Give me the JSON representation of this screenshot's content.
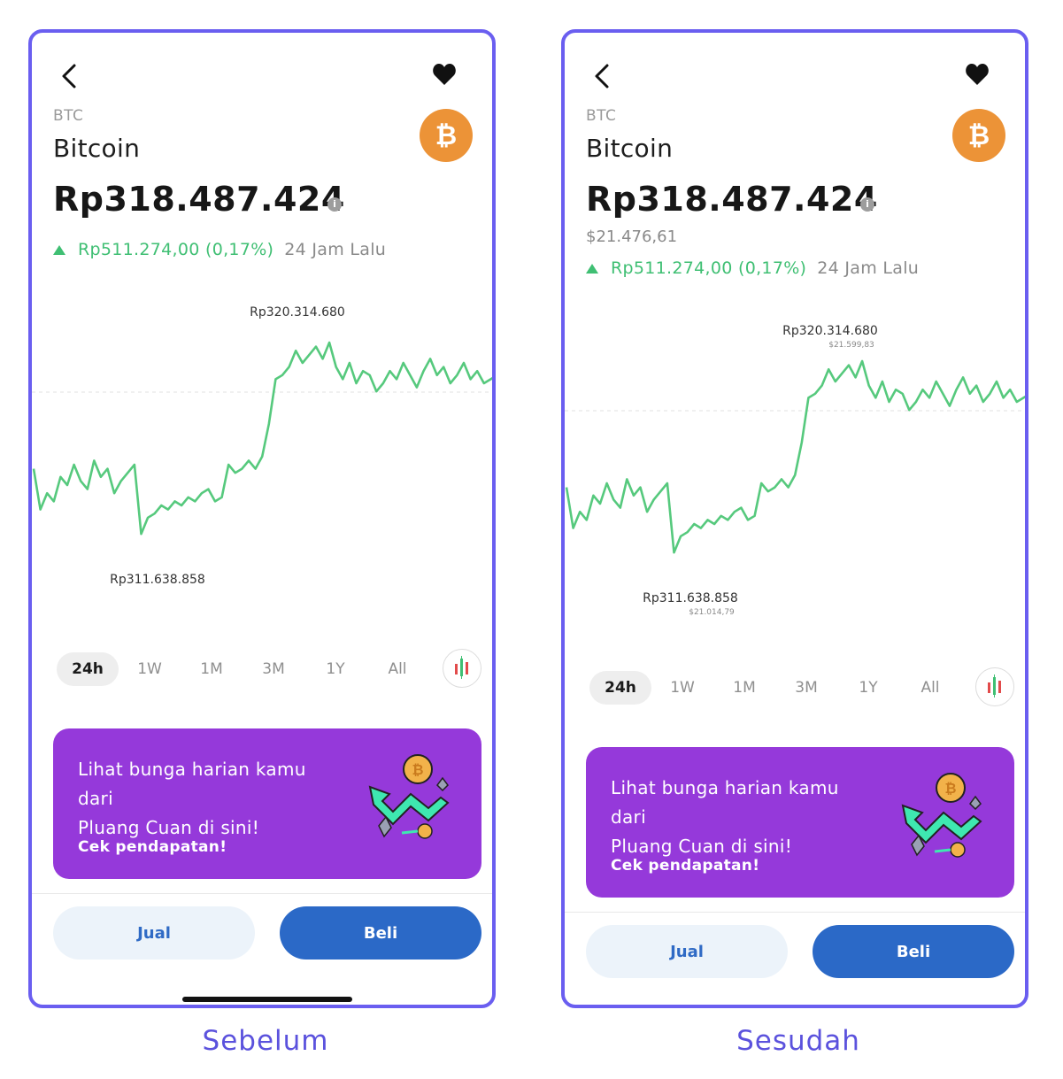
{
  "panels": {
    "before": {
      "ticker": "BTC",
      "name": "Bitcoin",
      "price": "Rp318.487.424",
      "change_value": "Rp511.274,00 (0,17%)",
      "change_period": "24 Jam Lalu",
      "chart_high": "Rp320.314.680",
      "chart_low": "Rp311.638.858",
      "ranges": [
        "24h",
        "1W",
        "1M",
        "3M",
        "1Y",
        "All"
      ],
      "active_range": "24h",
      "promo": {
        "line1": "Lihat bunga harian kamu dari",
        "line2": "Pluang Cuan di sini!",
        "cta": "Cek pendapatan!"
      },
      "sell_label": "Jual",
      "buy_label": "Beli",
      "caption": "Sebelum"
    },
    "after": {
      "ticker": "BTC",
      "name": "Bitcoin",
      "price": "Rp318.487.424",
      "usd_price": "$21.476,61",
      "change_value": "Rp511.274,00 (0,17%)",
      "change_period": "24 Jam Lalu",
      "chart_high": "Rp320.314.680",
      "chart_high_usd": "$21.599,83",
      "chart_low": "Rp311.638.858",
      "chart_low_usd": "$21.014,79",
      "ranges": [
        "24h",
        "1W",
        "1M",
        "3M",
        "1Y",
        "All"
      ],
      "active_range": "24h",
      "promo": {
        "line1": "Lihat bunga harian kamu dari",
        "line2": "Pluang Cuan di sini!",
        "cta": "Cek pendapatan!"
      },
      "sell_label": "Jual",
      "buy_label": "Beli",
      "caption": "Sesudah"
    }
  },
  "icons": {
    "back": "chevron-left-icon",
    "favorite": "heart-icon",
    "coin": "bitcoin-icon",
    "info": "info-icon",
    "candlestick": "candlestick-chart-icon",
    "promo_art": "growth-arrow-coins-illustration"
  },
  "colors": {
    "frame": "#6a5ef0",
    "positive": "#3fbf73",
    "coin": "#ec9337",
    "promo": "#9539da",
    "buy": "#2b69c7",
    "sell_bg": "#ecf3fa"
  },
  "chart_line": [
    0.62,
    0.82,
    0.74,
    0.78,
    0.66,
    0.7,
    0.6,
    0.68,
    0.72,
    0.58,
    0.66,
    0.62,
    0.74,
    0.68,
    0.64,
    0.6,
    0.94,
    0.86,
    0.84,
    0.8,
    0.82,
    0.78,
    0.8,
    0.76,
    0.78,
    0.74,
    0.72,
    0.78,
    0.76,
    0.6,
    0.64,
    0.62,
    0.58,
    0.62,
    0.56,
    0.4,
    0.18,
    0.16,
    0.12,
    0.04,
    0.1,
    0.06,
    0.02,
    0.08,
    0.0,
    0.12,
    0.18,
    0.1,
    0.2,
    0.14,
    0.16,
    0.24,
    0.2,
    0.14,
    0.18,
    0.1,
    0.16,
    0.22,
    0.14,
    0.08,
    0.16,
    0.12,
    0.2,
    0.16,
    0.1,
    0.18,
    0.14,
    0.2,
    0.18,
    0.16
  ]
}
